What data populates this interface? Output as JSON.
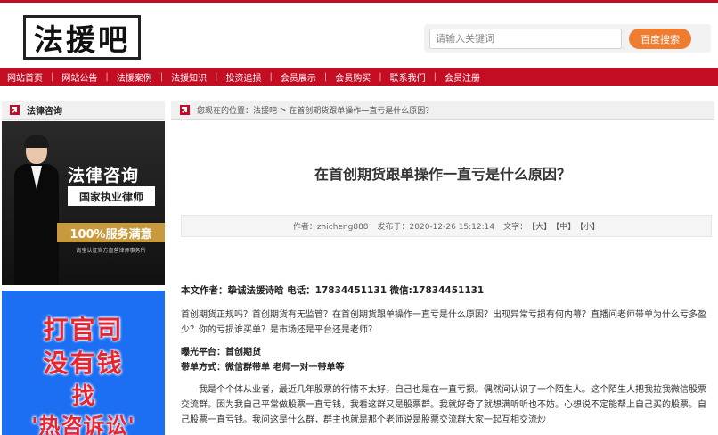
{
  "logo": {
    "text": "法援吧"
  },
  "search": {
    "placeholder": "请输入关键词",
    "button_label": "百度搜索"
  },
  "nav": {
    "items": [
      "网站首页",
      "网站公告",
      "法援案例",
      "法援知识",
      "投资追损",
      "会员展示",
      "会员购买",
      "联系我们",
      "会员注册"
    ]
  },
  "sidebar": {
    "title": "法律咨询",
    "ad1": {
      "title": "法律咨询",
      "subtitle": "国家执业律师",
      "band": "100%服务满意",
      "small": "淘宝认证官方直营律师事务所"
    },
    "ad2": {
      "line1": "打官司",
      "line2": "没有钱",
      "line3": "找",
      "line4": "'热咨诉讼'"
    }
  },
  "breadcrumb": {
    "prefix": "您现在的位置：",
    "home": "法援吧",
    "sep": " > ",
    "current": "在首创期货跟单操作一直亏是什么原因？"
  },
  "article": {
    "title": "在首创期货跟单操作一直亏是什么原因？",
    "meta": {
      "author": "作者：zhicheng888",
      "published": "发布于：2020-12-26 15:12:14",
      "font_label": "文字：",
      "size_large": "【大】",
      "size_medium": "【中】",
      "size_small": "【小】"
    },
    "author_line": "本文作者：挚诚法援诗晗 电话：17834451131 微信:17834451131",
    "intro": "首创期货正规吗？首创期货有无监管？在首创期货跟单操作一直亏是什么原因？出现异常亏损有何内幕？直播间老师带单为什么亏多盈少？你的亏损谁买单？是市场还是平台还是老师？",
    "platform_line": "曝光平台：首创期货",
    "method_line": "带单方式：微信群带单  老师一对一带单等",
    "body": "我是个个体从业者，最近几年股票的行情不太好，自己也是在一直亏损。偶然间认识了一个陌生人。这个陌生人把我拉我微信股票交流群。因为我自己平常做股票一直亏钱，我看这群又是股票群。我就好奇了就想满听听也不妨。心想说不定能帮上自己买的股票。自己股票一直亏钱。我问这是什么群，群主也就是那个老师说是股票交流群大家一起互相交流炒"
  }
}
